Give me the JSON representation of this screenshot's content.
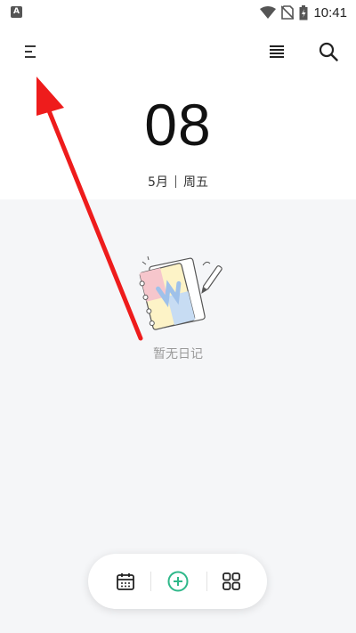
{
  "status_bar": {
    "time": "10:41",
    "app_badge_letter": "A",
    "icons": [
      "wifi-icon",
      "no-sim-icon",
      "battery-charging-icon"
    ]
  },
  "top_bar": {
    "icons": [
      "menu-icon",
      "list-view-icon",
      "search-icon"
    ]
  },
  "date_header": {
    "day": "08",
    "month": "5月",
    "weekday": "周五"
  },
  "empty_state": {
    "message": "暂无日记",
    "illustration": "notebook-and-pen-illustration"
  },
  "bottom_nav": {
    "icons": [
      "calendar-icon",
      "add-circle-icon",
      "grid-icon"
    ],
    "accent_color": "#2fb88a"
  },
  "annotation": {
    "arrow_color": "#ee1c1c"
  }
}
